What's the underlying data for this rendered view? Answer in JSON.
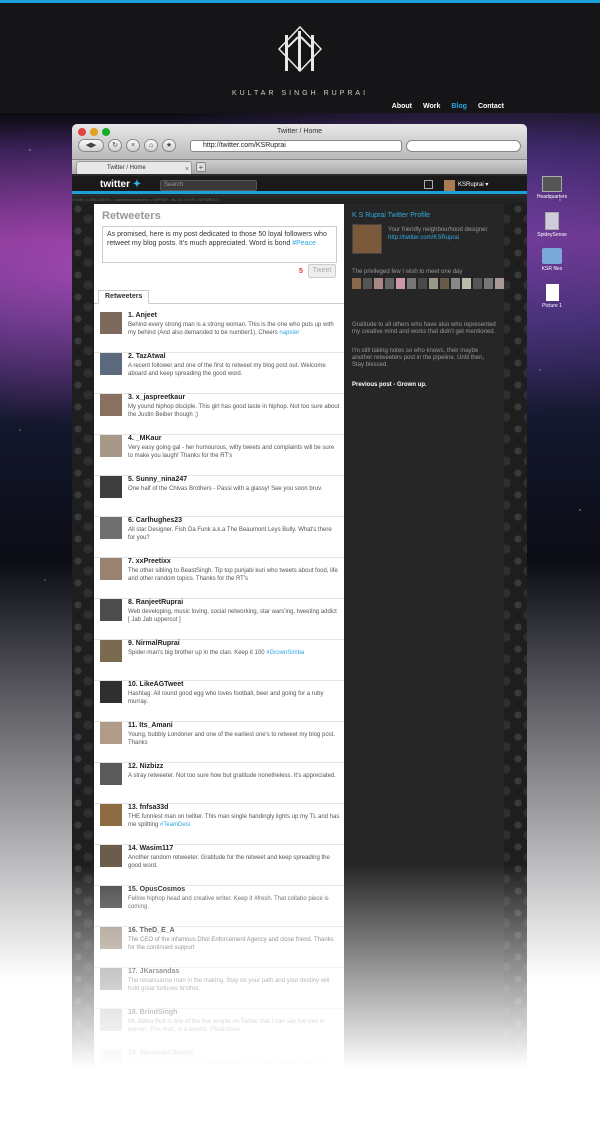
{
  "site": {
    "brand": "KULTAR SINGH RUPRAI",
    "nav": [
      {
        "label": "About",
        "active": false
      },
      {
        "label": "Work",
        "active": false
      },
      {
        "label": "Blog",
        "active": true
      },
      {
        "label": "Contact",
        "active": false
      }
    ]
  },
  "browser": {
    "window_title": "Twitter / Home",
    "url": "http://twitter.com/KSRuprai",
    "tab_label": "Twitter / Home",
    "tab_close": "×",
    "tab_add": "+"
  },
  "twitter": {
    "logo": "twitter",
    "search_placeholder": "Search",
    "username": "KSRuprai ▾",
    "ticker": "• KSR  • LONG DAYS • • #whatsinyourname • HIPHOP • BLOG • KSR • RETWEET •"
  },
  "main": {
    "heading": "Retweeters",
    "tweet_text": "As promised, here is my post dedicated to those 50 loyal followers who retweet my blog posts. It's much appreciated. Word is bond ",
    "tweet_hashtag": "#Peace",
    "char_count": "5",
    "tweet_button": "Tweet",
    "tab": "Retweeters",
    "retweeters": [
      {
        "name": "1. Anjeet",
        "bio": "Behind every strong man is a strong woman. This is the one who puts up with my behind (And also demanded to be number1). Cheers ",
        "link": "napster"
      },
      {
        "name": "2. TazAtwal",
        "bio": "A recent follower and one of the first to retweet my blog post out. Welcome aboard and keep spreading the good word.",
        "link": ""
      },
      {
        "name": "3. x_jaspreetkaur",
        "bio": "My yound hiphop disciple. This girl has good taste in hiphop. Not too sure about the Justin Beiber though ;)",
        "link": ""
      },
      {
        "name": "4. _MKaur",
        "bio": "Very easy going gal - her humourous, witty tweets and complaints will be sure to make you laugh! Thanks for the RT's",
        "link": ""
      },
      {
        "name": "5. Sunny_nina247",
        "bio": "One half of the Chivas Brothers - Passi with a glassy! See you soon bruv.",
        "link": ""
      },
      {
        "name": "6. Carlhughes23",
        "bio": "All star Designer. Fish Da Funk a.k.a The Beaumont Leys Bully. What's there for you?",
        "link": ""
      },
      {
        "name": "7. xxPreetixx",
        "bio": "The other sibling to BeastSingh. Tip top punjabi kuri who tweets about food, life and other random topics. Thanks for the RT's",
        "link": ""
      },
      {
        "name": "8. RanjeetRuprai",
        "bio": "Web developing, music loving, social networking, star wars'ing, tweeting addict [ Jab Jab uppercut ]",
        "link": ""
      },
      {
        "name": "9. NirmalRuprai",
        "bio": "Spider-man's big brother up in the clan. Keep it 100 ",
        "link": "#GrownSimba"
      },
      {
        "name": "10. LikeAGTweet",
        "bio": "Hashtag: All round good egg who loves football, beer and going for a ruby murray.",
        "link": ""
      },
      {
        "name": "11. Its_Amani",
        "bio": "Young, bubbly Londoner and one of the earliest one's to retweet my blog post. Thanks",
        "link": ""
      },
      {
        "name": "12. Nizbizz",
        "bio": "A stray retweeter. Not too sure how but gratitude nonetheless. It's appreciated.",
        "link": ""
      },
      {
        "name": "13. fnfsa33d",
        "bio": "THE funniest man on twitter. This man single handingly lights up my TL and has me splitting ",
        "link": "#TeamDesi"
      },
      {
        "name": "14. Wasim117",
        "bio": "Another random retweeter. Gratitude for the retweet and keep spreading the good word.",
        "link": ""
      },
      {
        "name": "15. OpusCosmos",
        "bio": "Fellow hiphop head and creative writer. Keep it #fresh. That collabo piece is coming.",
        "link": ""
      },
      {
        "name": "16. TheD_E_A",
        "bio": "The CEO of the infamous Dhol Enforcement Agency and close friend. Thanks for the continued support",
        "link": ""
      },
      {
        "name": "17. JKarsandas",
        "bio": "The renaissance man in the making. Stay on your path and your destiny will hold great fortunes brother.",
        "link": ""
      },
      {
        "name": "18. BrindSingh",
        "bio": "Mr. Bibba Putt is one of the few people on Twitter that I can say I've met in person. This man, is a legend. #TeamDesi",
        "link": ""
      },
      {
        "name": "19. ManinderJheeta",
        "bio": "So sure of myself. Its like he's somewhere on my page where he comes up",
        "link": ""
      }
    ]
  },
  "sidebar": {
    "title": "K S Ruprai Twitter Profile",
    "tagline": "Your friendly neighbourhood designer ",
    "profile_link": "http://twitter.com/KSRuprai",
    "few_heading": "The privileged few I wish to meet one day",
    "gratitude": "Gratitude to all others who have also who represented my creative mind and works that didn't get mentioned.",
    "still_taking": "I'm still taking notes so who knows, their maybe another retweeters post in the pipeline. Until then, Stay blessed.",
    "prev_post": "Previous post - Grown up."
  },
  "desktop": [
    {
      "label": "Headquarters",
      "icon": "monitor-icon"
    },
    {
      "label": "SpideySense",
      "icon": "drive-icon"
    },
    {
      "label": "KSR files",
      "icon": "folder-icon"
    },
    {
      "label": "Picture 1",
      "icon": "document-icon"
    }
  ],
  "colors": {
    "accent": "#1da0d8",
    "link": "#2ba6e0",
    "counter": "#dd3333"
  }
}
